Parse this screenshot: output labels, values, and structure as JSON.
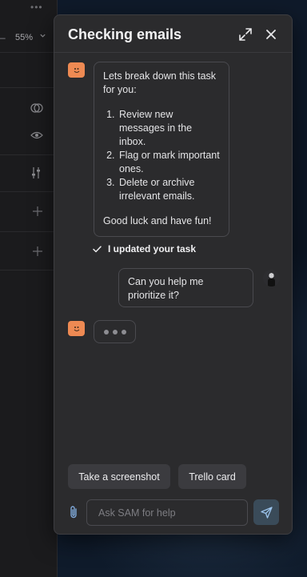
{
  "background": {
    "water_color": "#0d1726"
  },
  "left_panel": {
    "zoom": "55%",
    "more_dots": "•••",
    "dash": "–"
  },
  "chat": {
    "title": "Checking emails",
    "accent_color": "#ee8a53",
    "messages": [
      {
        "from": "bot",
        "intro": "Lets break down this task for you:",
        "steps": [
          "Review new messages in the inbox.",
          "Flag or mark important ones.",
          "Delete or archive irrelevant emails."
        ],
        "outro": "Good luck and have fun!"
      },
      {
        "from": "system",
        "text": "I updated your task"
      },
      {
        "from": "user",
        "text": "Can you help me prioritize it?"
      },
      {
        "from": "bot",
        "typing": true
      }
    ],
    "suggestions": [
      "Take a screenshot",
      "Trello card"
    ],
    "input": {
      "placeholder": "Ask SAM for help",
      "value": ""
    },
    "icons": {
      "expand": "expand-icon",
      "close": "close-icon",
      "attach": "paperclip-icon",
      "send": "send-icon",
      "check": "check-icon"
    }
  }
}
